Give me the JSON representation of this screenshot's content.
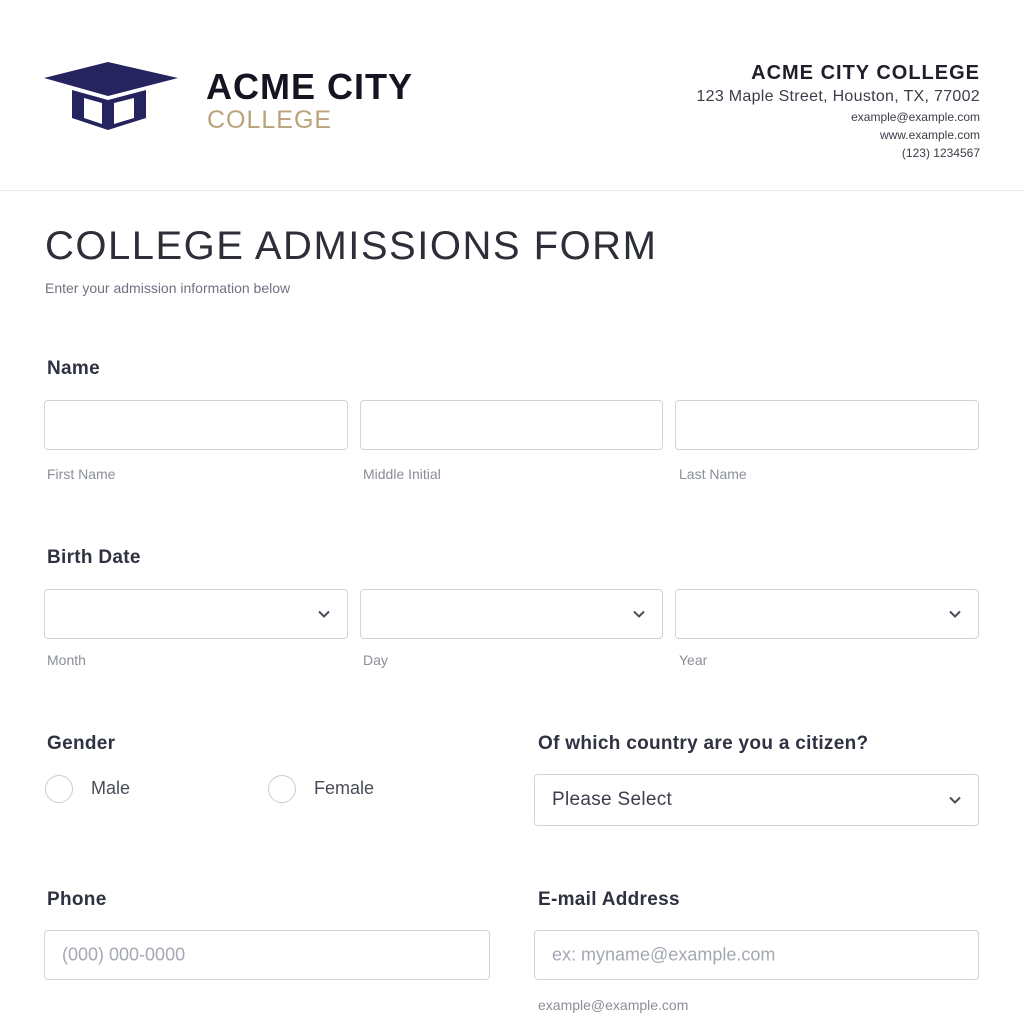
{
  "header": {
    "logo_line1": "ACME CITY",
    "logo_line2": "COLLEGE",
    "contact_name": "ACME CITY COLLEGE",
    "contact_address": "123 Maple Street, Houston, TX, 77002",
    "contact_email": "example@example.com",
    "contact_web": "www.example.com",
    "contact_phone": "(123) 1234567"
  },
  "form": {
    "title": "COLLEGE ADMISSIONS FORM",
    "subtitle": "Enter your admission information below",
    "name": {
      "label": "Name",
      "first": "First Name",
      "middle": "Middle Initial",
      "last": "Last Name"
    },
    "birth": {
      "label": "Birth Date",
      "month": "Month",
      "day": "Day",
      "year": "Year"
    },
    "gender": {
      "label": "Gender",
      "male": "Male",
      "female": "Female"
    },
    "country": {
      "label": "Of which country are you a citizen?",
      "selected": "Please Select"
    },
    "phone": {
      "label": "Phone",
      "placeholder": "(000) 000-0000"
    },
    "email": {
      "label": "E-mail Address",
      "placeholder": "ex: myname@example.com",
      "sublabel": "example@example.com"
    }
  },
  "colors": {
    "logo_navy": "#25245f",
    "logo_gold": "#b8a37a",
    "border": "#cfd3db"
  },
  "icons": {
    "logo": "graduation-cap-icon",
    "select_chevron": "chevron-down-icon"
  }
}
